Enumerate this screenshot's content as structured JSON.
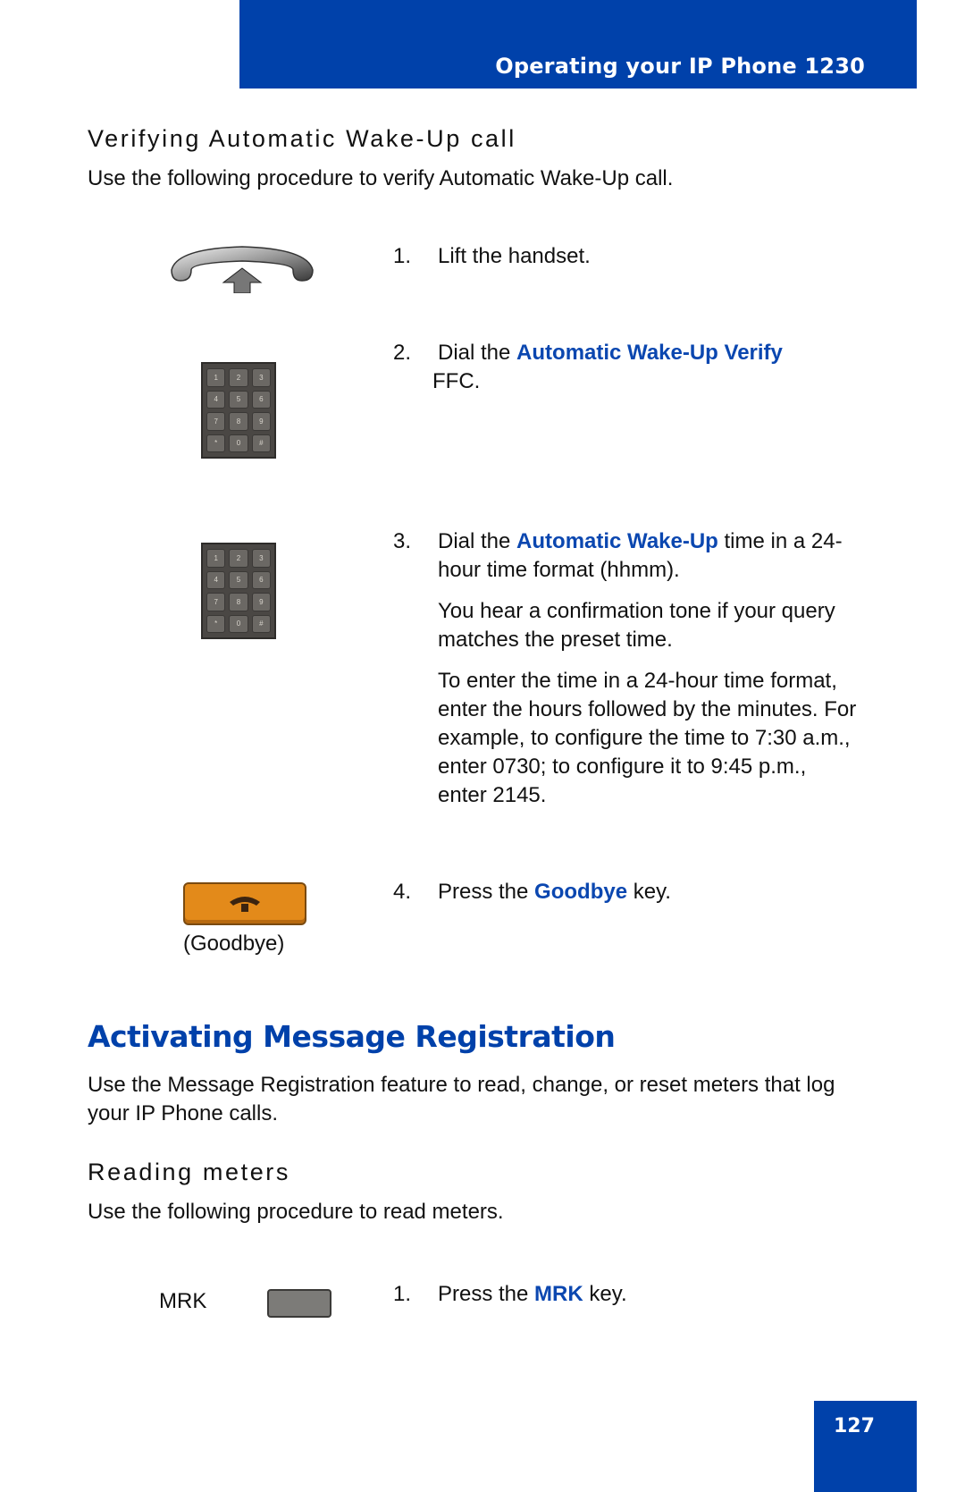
{
  "header": {
    "title": "Operating your IP Phone 1230"
  },
  "section_verify": {
    "heading": "Verifying Automatic Wake-Up call",
    "intro": "Use the following procedure to verify Automatic Wake-Up call.",
    "steps": [
      {
        "num": "1.",
        "parts": [
          {
            "text": "Lift the handset."
          }
        ],
        "icon": "handset-lift-icon"
      },
      {
        "num": "2.",
        "parts": [
          {
            "text": "Dial the "
          },
          {
            "text": "Automatic Wake-Up Verify",
            "kw": true
          },
          {
            "text": " FFC."
          }
        ],
        "icon": "keypad-icon"
      },
      {
        "num": "3.",
        "parts": [
          {
            "text": "Dial the "
          },
          {
            "text": "Automatic Wake-Up",
            "kw": true
          },
          {
            "text": " time in a 24-hour time format (hhmm)."
          }
        ],
        "notes": [
          "You hear a confirmation tone if your query matches the preset time.",
          "To enter the time in a 24-hour time format, enter the hours followed by the minutes. For example, to configure the time to 7:30 a.m., enter 0730; to configure it to 9:45 p.m., enter 2145."
        ],
        "icon": "keypad-icon"
      },
      {
        "num": "4.",
        "parts": [
          {
            "text": "Press the "
          },
          {
            "text": "Goodbye",
            "kw": true
          },
          {
            "text": " key."
          }
        ],
        "icon": "goodbye-key-icon",
        "icon_caption": "(Goodbye)"
      }
    ]
  },
  "section_message_registration": {
    "heading": "Activating Message Registration",
    "intro": "Use the Message Registration feature to read, change, or reset meters that log your IP Phone calls."
  },
  "section_reading_meters": {
    "heading": "Reading meters",
    "intro": "Use the following procedure to read meters.",
    "key_label": "MRK",
    "steps": [
      {
        "num": "1.",
        "parts": [
          {
            "text": "Press the "
          },
          {
            "text": "MRK",
            "kw": true
          },
          {
            "text": " key."
          }
        ]
      }
    ]
  },
  "keypad_keys": [
    "1",
    "2",
    "3",
    "4",
    "5",
    "6",
    "7",
    "8",
    "9",
    "*",
    "0",
    "#"
  ],
  "page_number": "127",
  "colors": {
    "brand_blue": "#0041aa",
    "keyword_blue": "#0b47b0",
    "goodbye_orange": "#e38a1a"
  }
}
